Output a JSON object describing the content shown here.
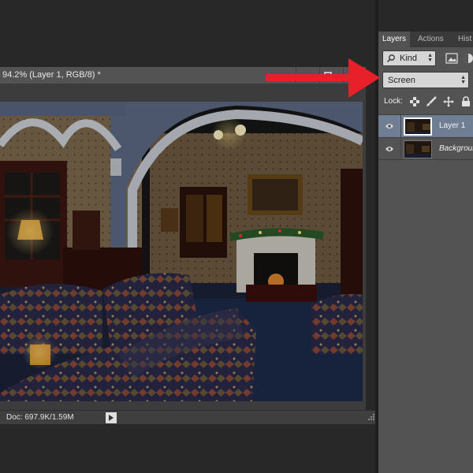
{
  "document": {
    "title": "94.2% (Layer 1, RGB/8) *",
    "status": "Doc: 697.9K/1.59M"
  },
  "layers_panel": {
    "tabs": [
      {
        "label": "Layers",
        "active": true
      },
      {
        "label": "Actions",
        "active": false
      },
      {
        "label": "Hist",
        "active": false
      }
    ],
    "filter_kind": "Kind",
    "blend_mode": "Screen",
    "lock_label": "Lock:",
    "layers": [
      {
        "name": "Layer 1",
        "selected": true,
        "visible": true
      },
      {
        "name": "Background",
        "selected": false,
        "visible": true
      }
    ]
  },
  "colors": {
    "panel": "#535353",
    "selected_layer": "#6f7e93",
    "annotation_arrow": "#e8202a"
  },
  "icons": [
    "search-icon",
    "image-filter-icon",
    "adjustment-filter-icon",
    "lock-transparent-icon",
    "lock-paint-icon",
    "lock-move-icon",
    "lock-all-icon",
    "eye-icon",
    "nav-arrow-icon",
    "red-arrow-annotation"
  ]
}
